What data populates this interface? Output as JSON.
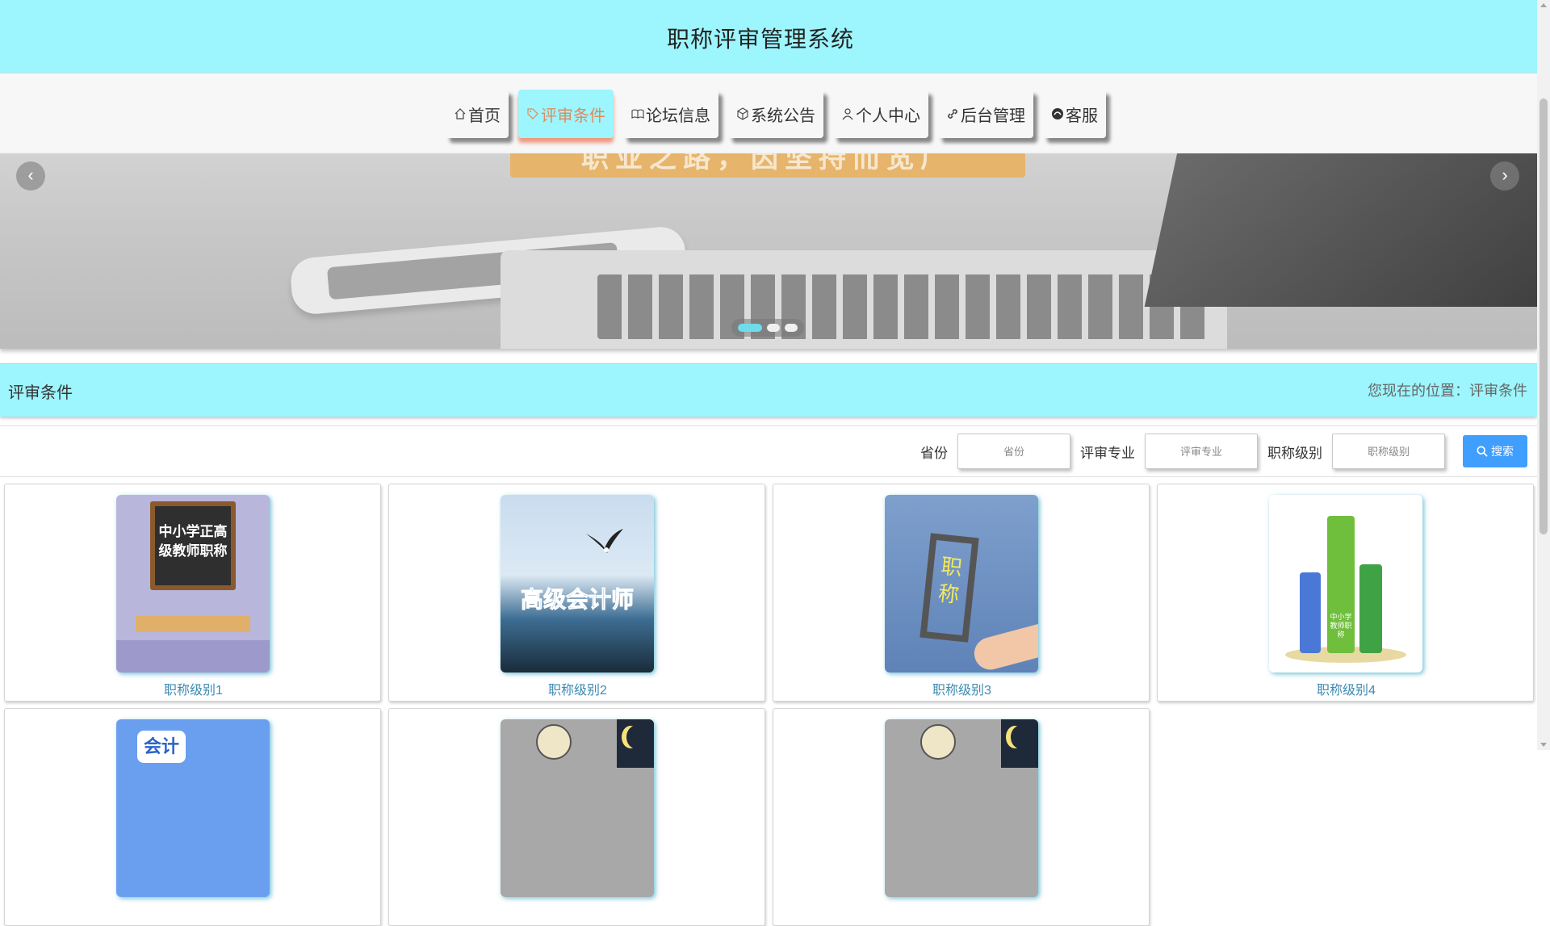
{
  "header": {
    "title": "职称评审管理系统"
  },
  "nav": {
    "items": [
      {
        "label": "首页",
        "icon": "home-icon"
      },
      {
        "label": "评审条件",
        "icon": "tag-icon",
        "active": true
      },
      {
        "label": "论坛信息",
        "icon": "forum-icon"
      },
      {
        "label": "系统公告",
        "icon": "cube-icon"
      },
      {
        "label": "个人中心",
        "icon": "user-icon"
      },
      {
        "label": "后台管理",
        "icon": "link-icon"
      },
      {
        "label": "客服",
        "icon": "service-icon"
      }
    ]
  },
  "carousel": {
    "banner_text": "职业之路，因坚持而宽广",
    "prev_icon": "chevron-left-icon",
    "next_icon": "chevron-right-icon",
    "slide_count": 3,
    "active_slide": 1
  },
  "section": {
    "title": "评审条件",
    "breadcrumb": "您现在的位置：评审条件"
  },
  "search": {
    "province_label": "省份",
    "province_placeholder": "省份",
    "major_label": "评审专业",
    "major_placeholder": "评审专业",
    "level_label": "职称级别",
    "level_placeholder": "职称级别",
    "button_label": "搜索",
    "button_icon": "search-icon"
  },
  "cards": [
    {
      "caption": "职称级别1",
      "image_text": "中小学正高级教师职称"
    },
    {
      "caption": "职称级别2",
      "image_text": "高级会计师"
    },
    {
      "caption": "职称级别3",
      "image_text": "职称"
    },
    {
      "caption": "职称级别4",
      "image_text": "中小学教师职称"
    },
    {
      "caption": "",
      "image_text": "会计"
    },
    {
      "caption": ""
    },
    {
      "caption": ""
    }
  ],
  "colors": {
    "header_bg": "#9df5fd",
    "active_text": "#e08a5e",
    "primary_button": "#409eff",
    "caption": "#3d8bb1"
  }
}
